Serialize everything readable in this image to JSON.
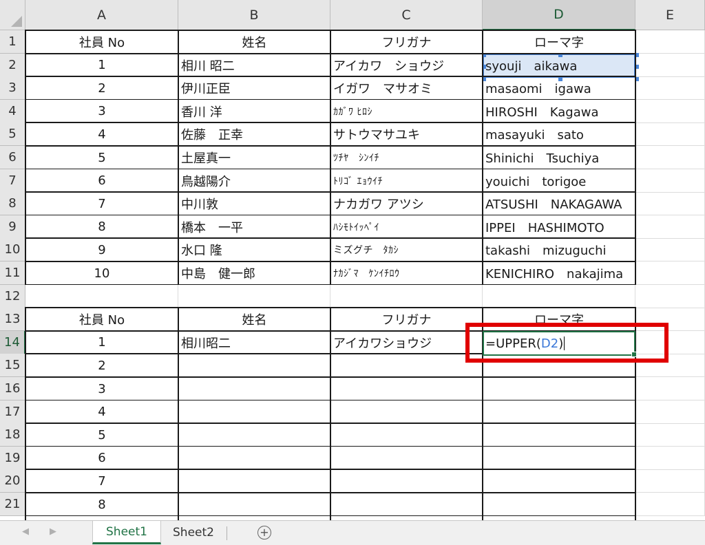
{
  "spreadsheet": {
    "columns": [
      "A",
      "B",
      "C",
      "D",
      "E"
    ],
    "rows": [
      "1",
      "2",
      "3",
      "4",
      "5",
      "6",
      "7",
      "8",
      "9",
      "10",
      "11",
      "12",
      "13",
      "14",
      "15",
      "16",
      "17",
      "18",
      "19",
      "20",
      "21"
    ],
    "selected_column": "D",
    "selected_row": "14"
  },
  "table1": {
    "headers": [
      "社員 No",
      "姓名",
      "フリガナ",
      "ローマ字"
    ],
    "rows": [
      [
        "1",
        "相川 昭二",
        "アイカワ　ショウジ",
        "syouji　aikawa"
      ],
      [
        "2",
        "伊川正臣",
        "イガワ　マサオミ",
        "masaomi　igawa"
      ],
      [
        "3",
        "香川 洋",
        "ｶｶﾞﾜ ﾋﾛｼ",
        "HIROSHI　Kagawa"
      ],
      [
        "4",
        "佐藤　正幸",
        "サトウマサユキ",
        "masayuki　sato"
      ],
      [
        "5",
        "土屋真一",
        "ﾂﾁﾔ　ｼﾝｲﾁ",
        "Shinichi　Tsuchiya"
      ],
      [
        "6",
        "鳥越陽介",
        "ﾄﾘｺﾞ ｴｮｳｲﾁ",
        "youichi　torigoe"
      ],
      [
        "7",
        "中川敦",
        "ナカガワ アツシ",
        "ATSUSHI　NAKAGAWA"
      ],
      [
        "8",
        "橋本　一平",
        "ﾊｼﾓﾄｲｯﾍﾟｲ",
        "IPPEI　HASHIMOTO"
      ],
      [
        "9",
        "水口 隆",
        "ミズグチ　ﾀｶｼ",
        "takashi　mizuguchi"
      ],
      [
        "10",
        "中島　健一郎",
        "ﾅｶｼﾞﾏ　ｹﾝｲﾁﾛｳ",
        "KENICHIRO　nakajima"
      ]
    ]
  },
  "table2": {
    "headers": [
      "社員 No",
      "姓名",
      "フリガナ",
      "ローマ字"
    ],
    "rows": [
      [
        "1",
        "相川昭二",
        "アイカワショウジ",
        ""
      ],
      [
        "2",
        "",
        "",
        ""
      ],
      [
        "3",
        "",
        "",
        ""
      ],
      [
        "4",
        "",
        "",
        ""
      ],
      [
        "5",
        "",
        "",
        ""
      ],
      [
        "6",
        "",
        "",
        ""
      ],
      [
        "7",
        "",
        "",
        ""
      ],
      [
        "8",
        "",
        "",
        ""
      ]
    ]
  },
  "editing_cell": {
    "formula_prefix": "=UPPER(",
    "formula_ref": "D2",
    "formula_suffix": ")"
  },
  "sheet_tabs": [
    {
      "label": "Sheet1",
      "active": true
    },
    {
      "label": "Sheet2",
      "active": false
    }
  ],
  "add_sheet_symbol": "+",
  "colors": {
    "accent_green": "#217346",
    "selection_blue": "#4a86d8",
    "highlight_red": "#e00000"
  }
}
